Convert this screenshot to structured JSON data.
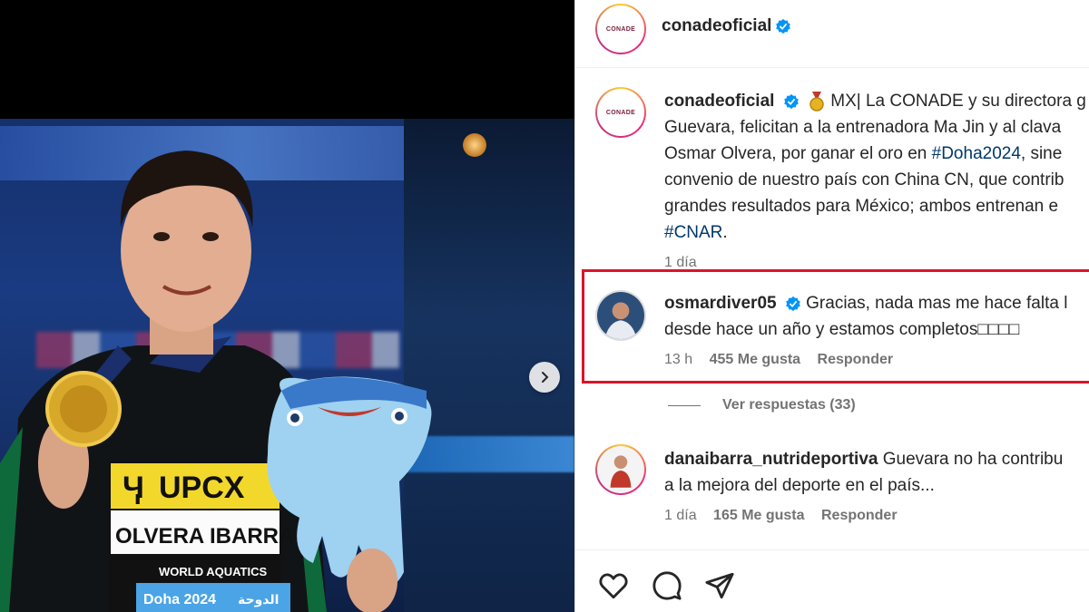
{
  "post": {
    "username": "conadeoficial",
    "avatar_text": "CONADE"
  },
  "photo": {
    "bib_brand": "UPCX",
    "bib_name": "OLVERA IBARRA",
    "bib_org": "WORLD AQUATICS",
    "bib_event": "Doha 2024",
    "bib_event_ar": "الدوحة"
  },
  "caption": {
    "username": "conadeoficial",
    "line1_text": "MX| La CONADE y su directora g",
    "line2": "Guevara, felicitan a la entrenadora Ma Jin y al clava",
    "line3_pre": "Osmar Olvera, por ganar el oro en ",
    "line3_tag": "#Doha2024",
    "line3_post": ", sine",
    "line4": "convenio de nuestro país con China CN, que contrib",
    "line5": "grandes resultados para México; ambos entrenan e",
    "line6_tag": "#CNAR",
    "line6_post": ".",
    "time": "1 día"
  },
  "comment1": {
    "username": "osmardiver05",
    "line1": "Gracias, nada mas me hace falta l",
    "line2": "desde hace un año y estamos completos□□□□",
    "time": "13 h",
    "likes": "455 Me gusta",
    "reply": "Responder"
  },
  "view_replies": "Ver respuestas (33)",
  "comment2": {
    "username": "danaibarra_nutrideportiva",
    "line1": "Guevara no ha contribu",
    "line2": "a la mejora del deporte en el país...",
    "time": "1 día",
    "likes": "165 Me gusta",
    "reply": "Responder"
  },
  "colors": {
    "verified": "#0095f6",
    "hashtag": "#00376b",
    "highlight_box": "#d9142b",
    "meta": "#737373"
  },
  "icons": [
    "heart-icon",
    "comment-icon",
    "share-icon",
    "verified-icon",
    "chevron-right-icon",
    "medal-icon"
  ]
}
